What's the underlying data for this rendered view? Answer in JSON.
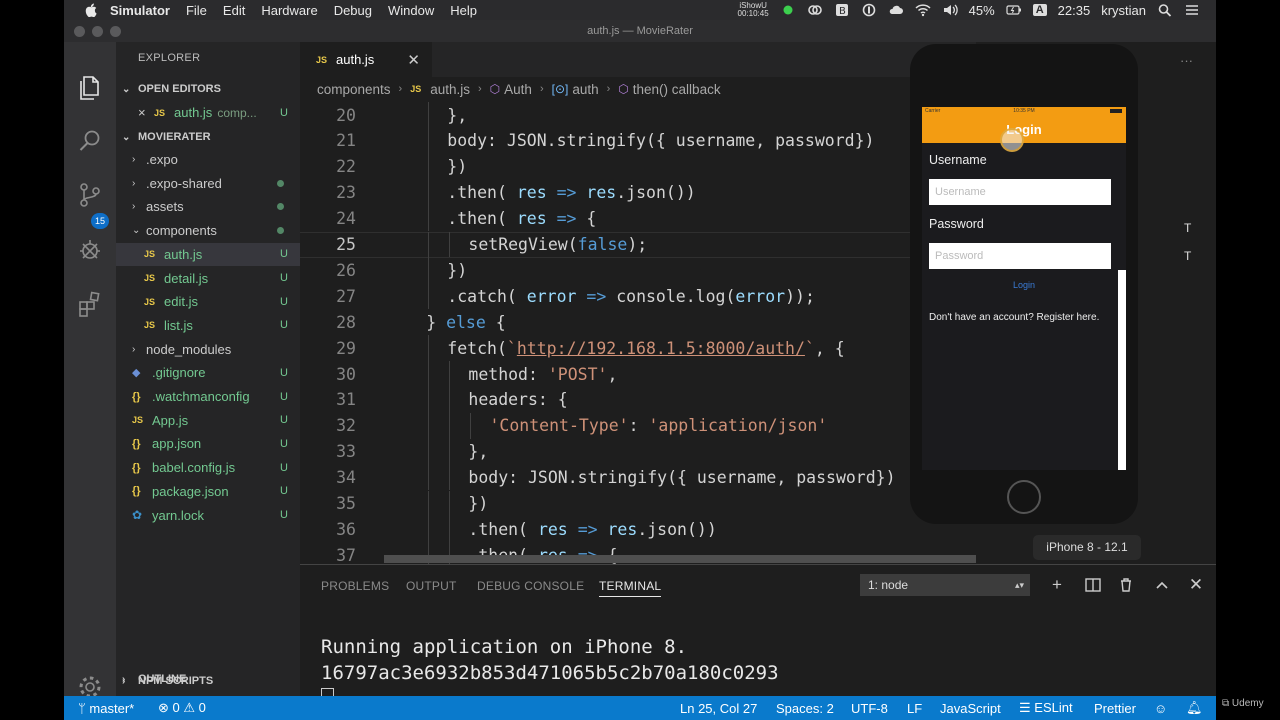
{
  "menubar": {
    "items": [
      "Simulator",
      "File",
      "Edit",
      "Hardware",
      "Debug",
      "Window",
      "Help"
    ],
    "ishowu_name": "iShowU",
    "ishowu_time": "00:10:45",
    "battery": "45%",
    "input_letter": "A",
    "clock": "22:35",
    "user": "krystian"
  },
  "window": {
    "title": "auth.js — MovieRater"
  },
  "activity": {
    "scm_badge": "15"
  },
  "sidebar": {
    "title": "EXPLORER",
    "open_editors_label": "OPEN EDITORS",
    "open_editor": {
      "name": "auth.js",
      "path": "comp...",
      "status": "U"
    },
    "project_label": "MOVIERATER",
    "tree": [
      {
        "name": ".expo",
        "kind": "folder",
        "status": ""
      },
      {
        "name": ".expo-shared",
        "kind": "folder",
        "status": "dot"
      },
      {
        "name": "assets",
        "kind": "folder",
        "status": "dot"
      },
      {
        "name": "components",
        "kind": "folder-open",
        "status": "dot"
      },
      {
        "name": "auth.js",
        "kind": "js",
        "status": "U"
      },
      {
        "name": "detail.js",
        "kind": "js",
        "status": "U"
      },
      {
        "name": "edit.js",
        "kind": "js",
        "status": "U"
      },
      {
        "name": "list.js",
        "kind": "js",
        "status": "U"
      },
      {
        "name": "node_modules",
        "kind": "folder",
        "status": ""
      },
      {
        "name": ".gitignore",
        "kind": "git",
        "status": "U"
      },
      {
        "name": ".watchmanconfig",
        "kind": "json",
        "status": "U"
      },
      {
        "name": "App.js",
        "kind": "js",
        "status": "U"
      },
      {
        "name": "app.json",
        "kind": "json",
        "status": "U"
      },
      {
        "name": "babel.config.js",
        "kind": "json",
        "status": "U"
      },
      {
        "name": "package.json",
        "kind": "json",
        "status": "U"
      },
      {
        "name": "yarn.lock",
        "kind": "yarn",
        "status": "U"
      }
    ],
    "outline_label": "OUTLINE",
    "npm_label": "NPM SCRIPTS"
  },
  "tab": {
    "name": "auth.js",
    "icon": "JS"
  },
  "breadcrumbs": [
    "components",
    "auth.js",
    "Auth",
    "auth",
    "then() callback"
  ],
  "editor": {
    "lines": [
      {
        "n": "20",
        "indent": 6,
        "code": "},"
      },
      {
        "n": "21",
        "indent": 6,
        "code": "body: JSON.stringify({ username, password})"
      },
      {
        "n": "22",
        "indent": 6,
        "code": "})"
      },
      {
        "n": "23",
        "indent": 6,
        "code": ".then( res => res.json())"
      },
      {
        "n": "24",
        "indent": 6,
        "code": ".then( res => {"
      },
      {
        "n": "25",
        "indent": 8,
        "code": "setRegView(false);"
      },
      {
        "n": "26",
        "indent": 6,
        "code": "})"
      },
      {
        "n": "27",
        "indent": 6,
        "code": ".catch( error => console.log(error));"
      },
      {
        "n": "28",
        "indent": 4,
        "code": "} else {"
      },
      {
        "n": "29",
        "indent": 6,
        "code": "fetch(`http://192.168.1.5:8000/auth/`, {"
      },
      {
        "n": "30",
        "indent": 8,
        "code": "method: 'POST',"
      },
      {
        "n": "31",
        "indent": 8,
        "code": "headers: {"
      },
      {
        "n": "32",
        "indent": 10,
        "code": "'Content-Type': 'application/json'"
      },
      {
        "n": "33",
        "indent": 8,
        "code": "},"
      },
      {
        "n": "34",
        "indent": 8,
        "code": "body: JSON.stringify({ username, password})"
      },
      {
        "n": "35",
        "indent": 8,
        "code": "})"
      },
      {
        "n": "36",
        "indent": 8,
        "code": ".then( res => res.json())"
      },
      {
        "n": "37",
        "indent": 8,
        "code": ".then( res => {"
      }
    ],
    "current_line": "25"
  },
  "panel": {
    "tabs": [
      "PROBLEMS",
      "OUTPUT",
      "DEBUG CONSOLE",
      "TERMINAL"
    ],
    "active_tab": "TERMINAL",
    "terminal_select": "1: node",
    "terminal_lines": [
      "Running application on iPhone 8.",
      "16797ac3e6932b853d471065b5c2b70a180c0293"
    ]
  },
  "statusbar": {
    "branch": "master*",
    "errors": "0",
    "warnings": "0",
    "position": "Ln 25, Col 27",
    "spaces": "Spaces: 2",
    "encoding": "UTF-8",
    "eol": "LF",
    "language": "JavaScript",
    "eslint": "ESLint",
    "prettier": "Prettier"
  },
  "simulator": {
    "status_carrier": "Carrier",
    "status_time": "10:35 PM",
    "nav_title": "Login",
    "username_label": "Username",
    "username_placeholder": "Username",
    "password_label": "Password",
    "password_placeholder": "Password",
    "login_button": "Login",
    "register_text": "Don't have an account? Register here.",
    "device_caption": "iPhone 8 - 12.1",
    "cut_letter": "T"
  },
  "watermark": "Udemy",
  "colors": {
    "statusbar": "#0a7acc",
    "sim_navbar": "#f39c12",
    "editor_bg": "#1e1e1e",
    "keyword": "#569cd6",
    "string": "#ce9178"
  }
}
